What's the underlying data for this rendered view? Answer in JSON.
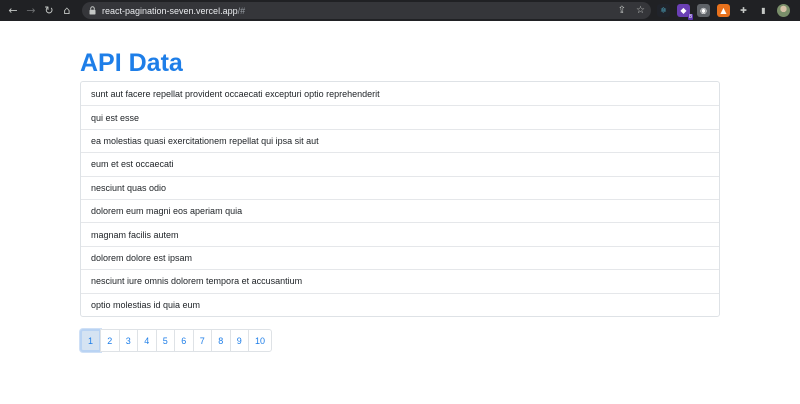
{
  "browser": {
    "url_host": "react-pagination-seven.vercel.app",
    "url_path": "/#",
    "nav": {
      "back_icon": "←",
      "forward_icon": "→",
      "reload_icon": "↻",
      "home_icon": "⌂"
    },
    "omnibox_icons": {
      "share": "⇪",
      "bookmark": "☆"
    },
    "extensions": [
      {
        "name": "react-devtools-icon",
        "glyph": "⚛",
        "color": "#61dafb",
        "bg": "#20232a"
      },
      {
        "name": "extension-purple-icon",
        "glyph": "◆",
        "color": "#ffffff",
        "bg": "#6a3fb5",
        "badge": "8"
      },
      {
        "name": "extension-gray-icon",
        "glyph": "◉",
        "color": "#ffffff",
        "bg": "#5f6368"
      },
      {
        "name": "extension-orange-icon",
        "glyph": "▲",
        "color": "#ffffff",
        "bg": "#e8711c"
      },
      {
        "name": "puzzle-icon",
        "glyph": "✚",
        "color": "#c4c7c5",
        "bg": "transparent"
      },
      {
        "name": "sidepanel-icon",
        "glyph": "▮",
        "color": "#c4c7c5",
        "bg": "transparent"
      }
    ],
    "menu_glyph": "⋮"
  },
  "page": {
    "title": "API Data",
    "items": [
      "sunt aut facere repellat provident occaecati excepturi optio reprehenderit",
      "qui est esse",
      "ea molestias quasi exercitationem repellat qui ipsa sit aut",
      "eum et est occaecati",
      "nesciunt quas odio",
      "dolorem eum magni eos aperiam quia",
      "magnam facilis autem",
      "dolorem dolore est ipsam",
      "nesciunt iure omnis dolorem tempora et accusantium",
      "optio molestias id quia eum"
    ],
    "pagination": {
      "pages": [
        "1",
        "2",
        "3",
        "4",
        "5",
        "6",
        "7",
        "8",
        "9",
        "10"
      ],
      "active": "1"
    }
  },
  "colors": {
    "accent": "#1e7ee8",
    "chrome_bg": "#202124",
    "omnibox_bg": "#35363a"
  }
}
